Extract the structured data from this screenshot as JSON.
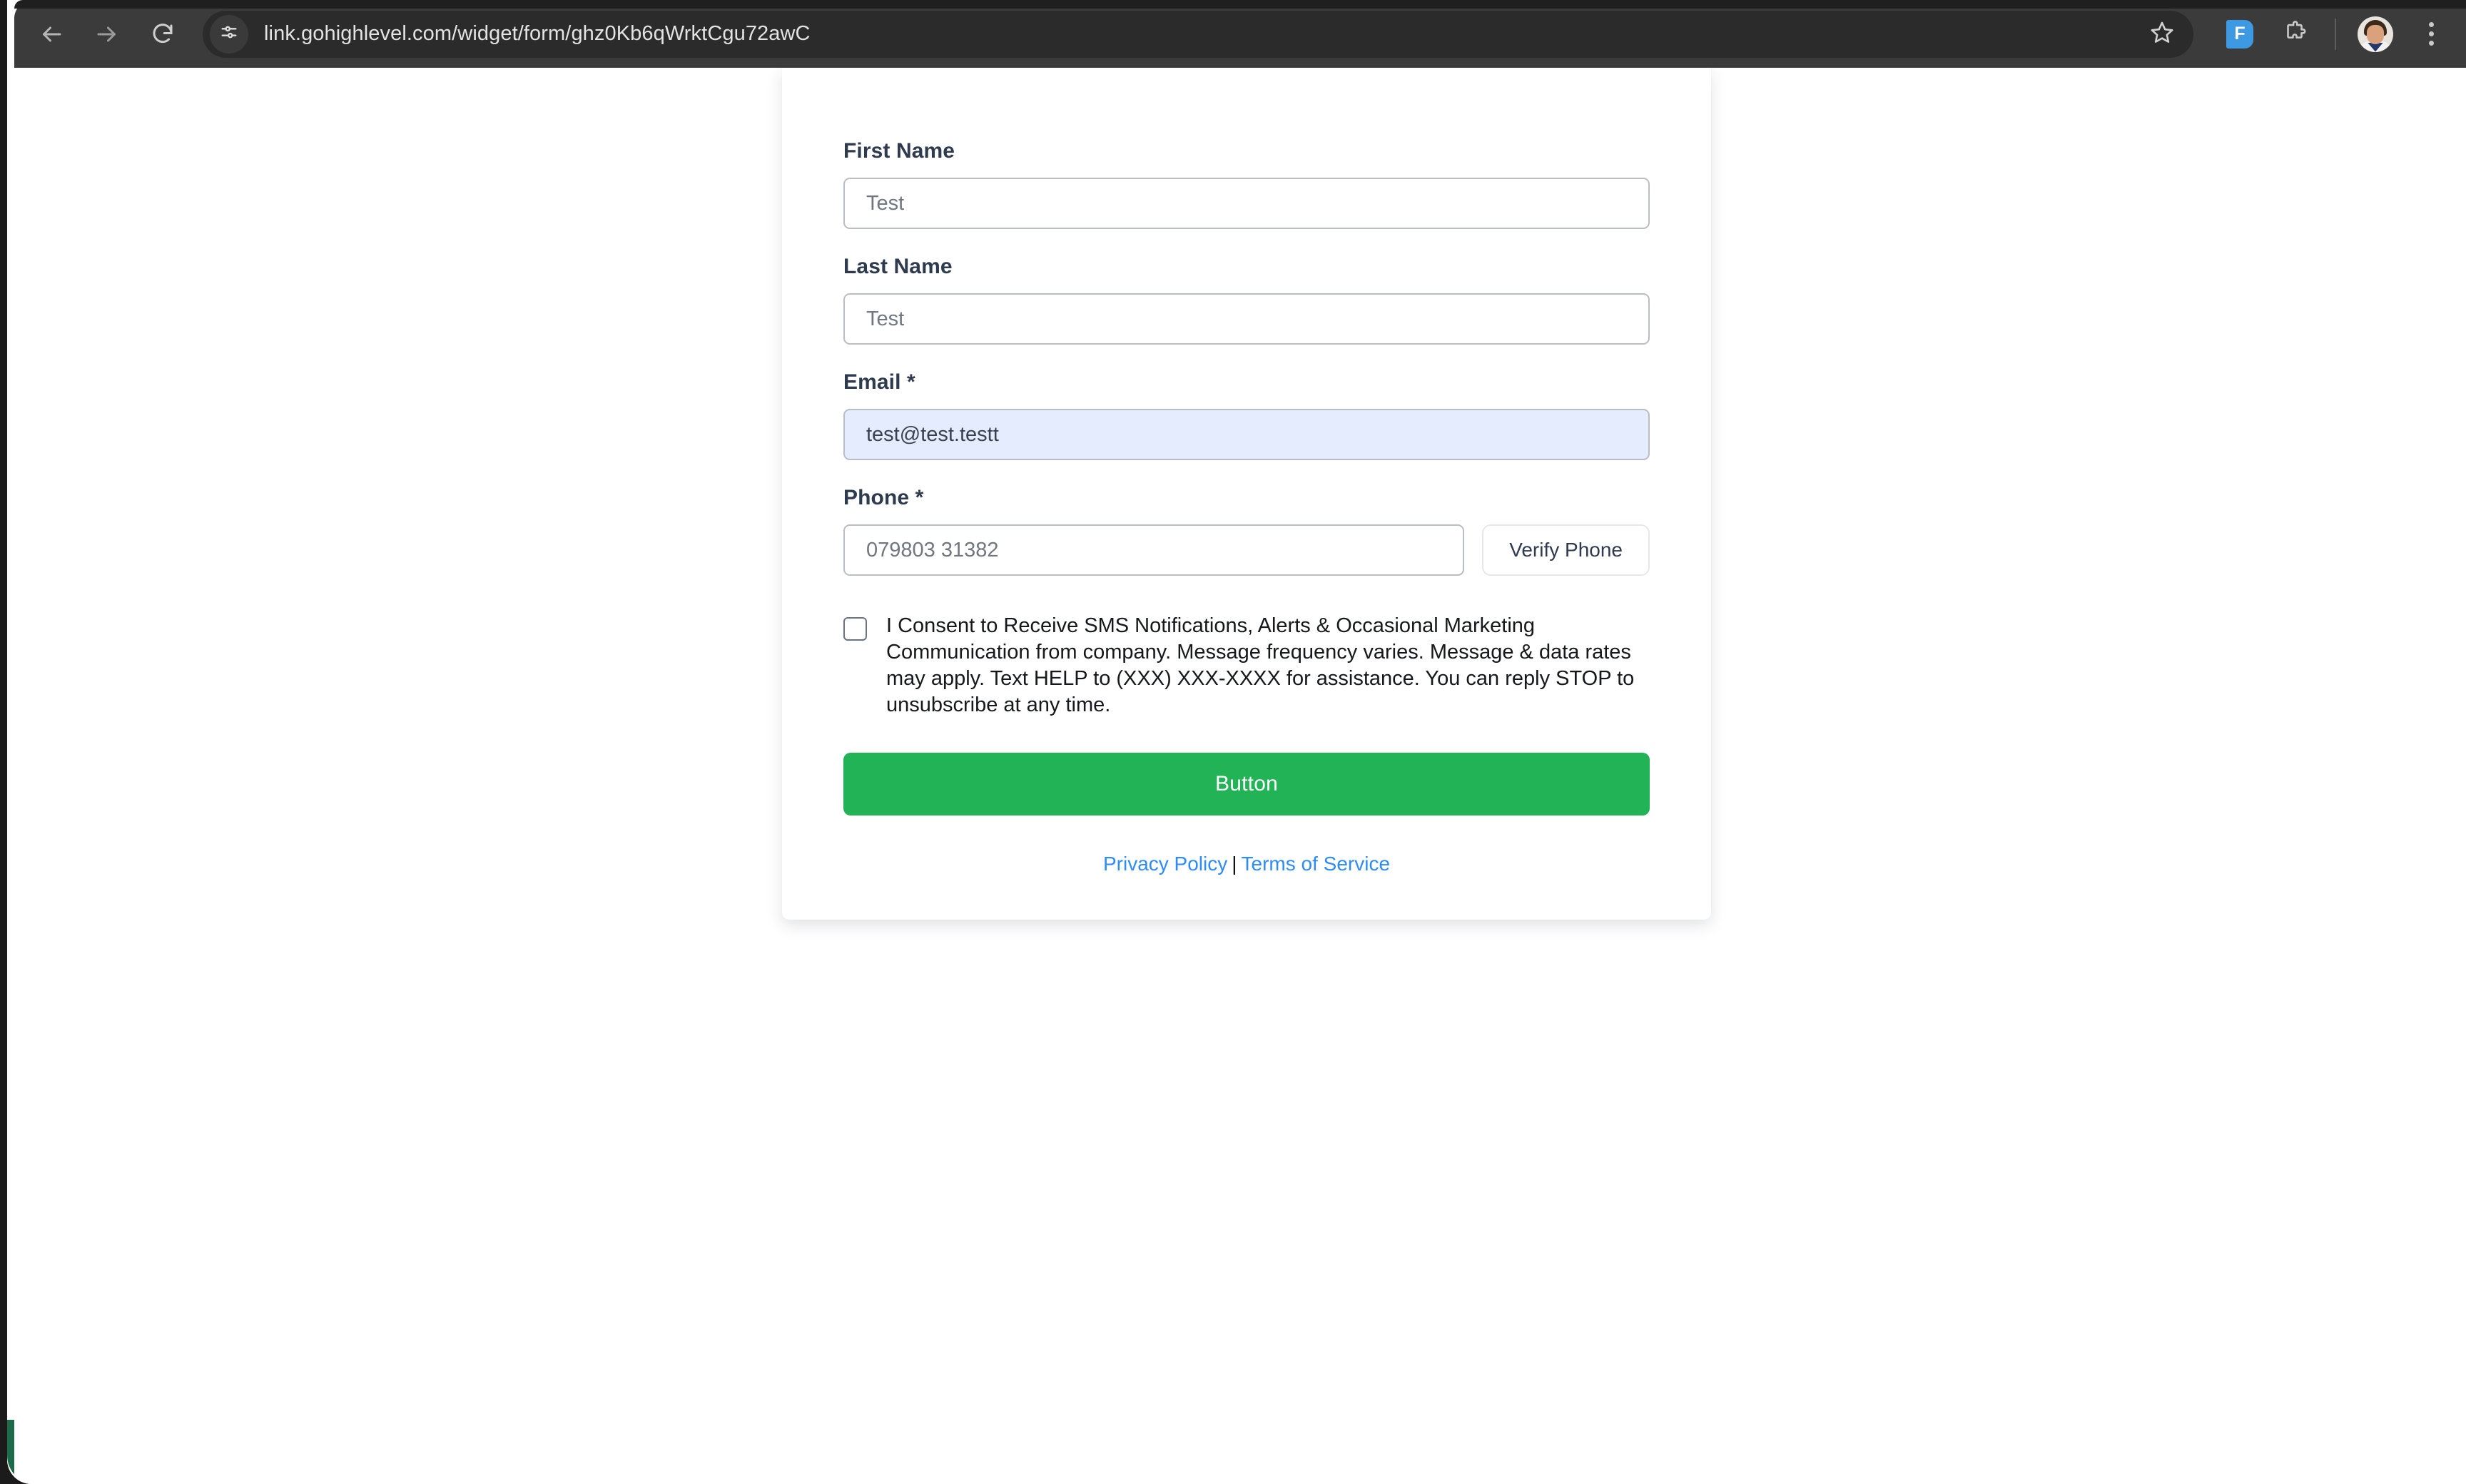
{
  "browser": {
    "url": "link.gohighlevel.com/widget/form/ghz0Kb6qWrktCgu72awC",
    "back_icon": "back-arrow-icon",
    "forward_icon": "forward-arrow-icon",
    "reload_icon": "reload-icon",
    "site_settings_icon": "tune-sliders-icon",
    "bookmark_icon": "star-outline-icon",
    "extension_badge_label": "F",
    "extensions_icon": "puzzle-piece-icon",
    "profile_icon": "account-avatar",
    "menu_icon": "three-dot-menu-icon",
    "toolbar_bg": "#3b3b3b",
    "omnibox_bg": "#2b2b2b"
  },
  "form": {
    "fields": [
      {
        "label": "First Name",
        "placeholder": "Test",
        "value": "",
        "name": "first-name"
      },
      {
        "label": "Last Name",
        "placeholder": "Test",
        "value": "",
        "name": "last-name"
      },
      {
        "label": "Email *",
        "placeholder": "test@test.testt",
        "value": "",
        "name": "email"
      },
      {
        "label": "Phone *",
        "placeholder": "079803 31382",
        "value": "",
        "name": "phone"
      }
    ],
    "verify_phone_label": "Verify Phone",
    "consent_text": "I Consent to Receive SMS Notifications, Alerts & Occasional Marketing Communication from company. Message frequency varies. Message & data rates may apply. Text HELP to (XXX) XXX-XXXX for assistance. You can reply STOP to unsubscribe at any time.",
    "consent_checked": false,
    "submit_label": "Button",
    "submit_color": "#22b356",
    "email_autofill_color": "#e5ecfd",
    "footer": {
      "privacy_policy": "Privacy Policy",
      "separator": "|",
      "terms_of_service": "Terms of Service",
      "link_color": "#2d8cf8"
    }
  }
}
